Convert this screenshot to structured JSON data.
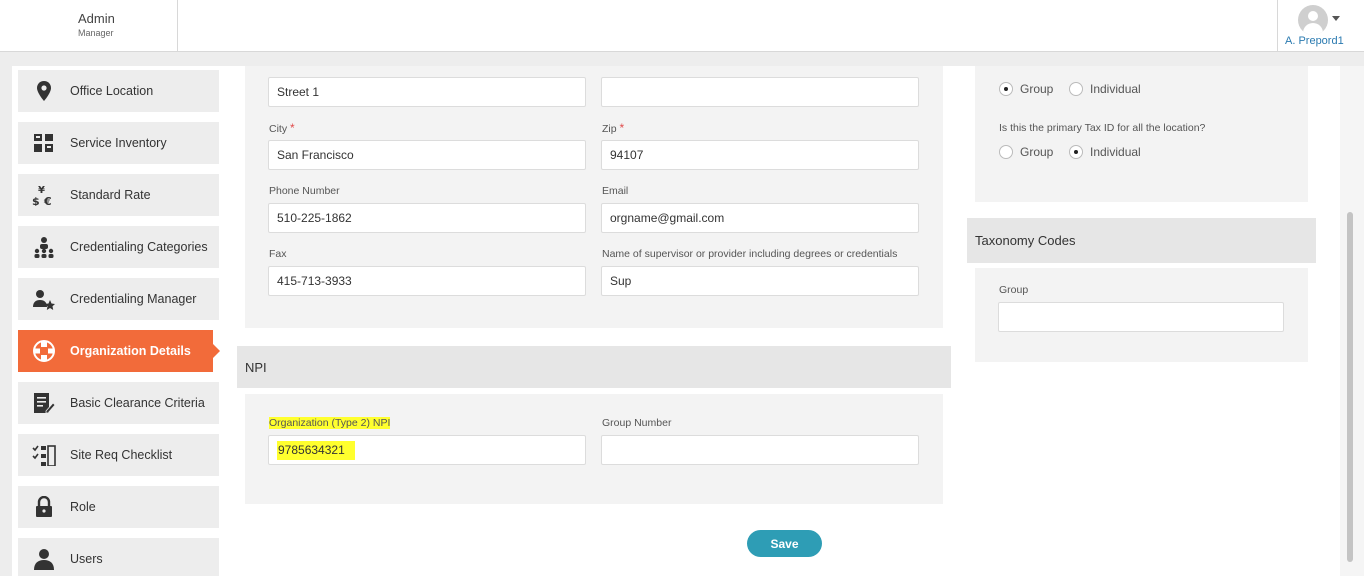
{
  "header": {
    "app_title": "Admin",
    "app_subtitle": "Manager",
    "user_name": "A. Prepord1"
  },
  "sidebar": {
    "items": [
      {
        "label": "Office Location",
        "icon": "location-pin-icon"
      },
      {
        "label": "Service Inventory",
        "icon": "inventory-icon"
      },
      {
        "label": "Standard Rate",
        "icon": "currency-icon"
      },
      {
        "label": "Credentialing Categories",
        "icon": "org-chart-icon"
      },
      {
        "label": "Credentialing Manager",
        "icon": "user-star-icon"
      },
      {
        "label": "Organization Details",
        "icon": "organization-icon",
        "active": true
      },
      {
        "label": "Basic Clearance Criteria",
        "icon": "edit-document-icon"
      },
      {
        "label": "Site Req Checklist",
        "icon": "checklist-icon"
      },
      {
        "label": "Role",
        "icon": "lock-icon"
      },
      {
        "label": "Users",
        "icon": "user-icon"
      }
    ]
  },
  "address": {
    "street1": {
      "value": "Street 1"
    },
    "street2": {
      "value": ""
    },
    "city": {
      "label": "City",
      "value": "San Francisco",
      "required": true
    },
    "zip": {
      "label": "Zip",
      "value": "94107",
      "required": true
    },
    "phone": {
      "label": "Phone Number",
      "value": "510-225-1862"
    },
    "email": {
      "label": "Email",
      "value": "orgname@gmail.com"
    },
    "fax": {
      "label": "Fax",
      "value": "415-713-3933"
    },
    "supervisor": {
      "label": "Name of supervisor or provider including degrees or credentials",
      "value": "Sup"
    }
  },
  "npi": {
    "heading": "NPI",
    "org_npi": {
      "label": "Organization (Type 2) NPI",
      "value": "9785634321"
    },
    "group_number": {
      "label": "Group Number",
      "value": ""
    }
  },
  "save_label": "Save",
  "tax": {
    "type_options": [
      "Group",
      "Individual"
    ],
    "type_selected": "Group",
    "primary_question": "Is this the primary Tax ID for all the location?",
    "primary_options": [
      "Group",
      "Individual"
    ],
    "primary_selected": "Individual"
  },
  "taxonomy": {
    "heading": "Taxonomy Codes",
    "group_label": "Group",
    "group_value": ""
  },
  "colors": {
    "accent": "#f26b3a",
    "button": "#2e9db5",
    "highlight": "#ffff2e",
    "link": "#2a7ab0",
    "required": "#e04b4b"
  }
}
